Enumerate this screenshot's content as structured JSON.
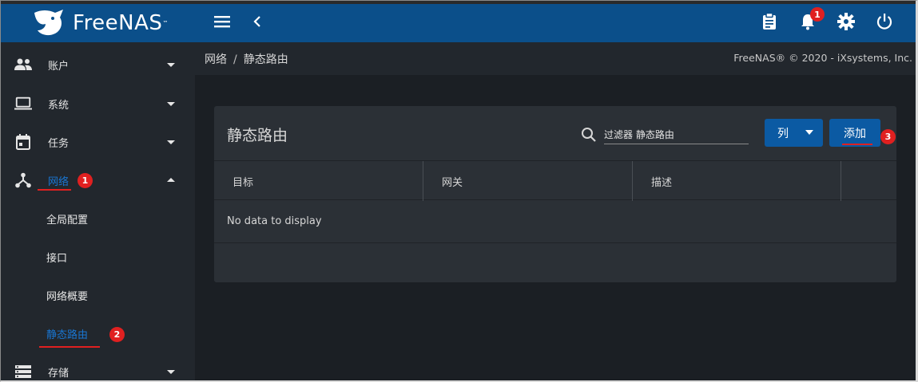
{
  "app": {
    "logo_text": "FreeNAS",
    "logo_tm": "™"
  },
  "topbar": {
    "notification_count": "1",
    "icons": [
      "menu-icon",
      "chevron-left-icon",
      "clipboard-icon",
      "bell-icon",
      "gear-icon",
      "power-icon"
    ]
  },
  "sidebar": {
    "items": [
      {
        "label": "账户",
        "icon": "users-icon"
      },
      {
        "label": "系统",
        "icon": "laptop-icon"
      },
      {
        "label": "任务",
        "icon": "calendar-icon"
      },
      {
        "label": "网络",
        "icon": "network-icon"
      },
      {
        "label": "存储",
        "icon": "storage-icon"
      }
    ],
    "network_children": [
      "全局配置",
      "接口",
      "网络概要",
      "静态路由"
    ]
  },
  "annotations": {
    "step1": "1",
    "step2": "2",
    "step3": "3"
  },
  "breadcrumb": {
    "parent": "网络",
    "separator": "/",
    "current": "静态路由"
  },
  "copyright": "FreeNAS® © 2020 - iXsystems, Inc.",
  "card": {
    "title": "静态路由",
    "search_placeholder": "过滤器 静态路由",
    "columns_button": "列",
    "add_button": "添加",
    "table_headers": [
      "目标",
      "网关",
      "描述"
    ],
    "empty_message": "No data to display"
  },
  "colors": {
    "topbar": "#0b4f8a",
    "sidebar": "#22272d",
    "main_bg": "#1b1f24",
    "card": "#2b3036",
    "accent": "#1976d2",
    "annotation_red": "#e02020"
  }
}
